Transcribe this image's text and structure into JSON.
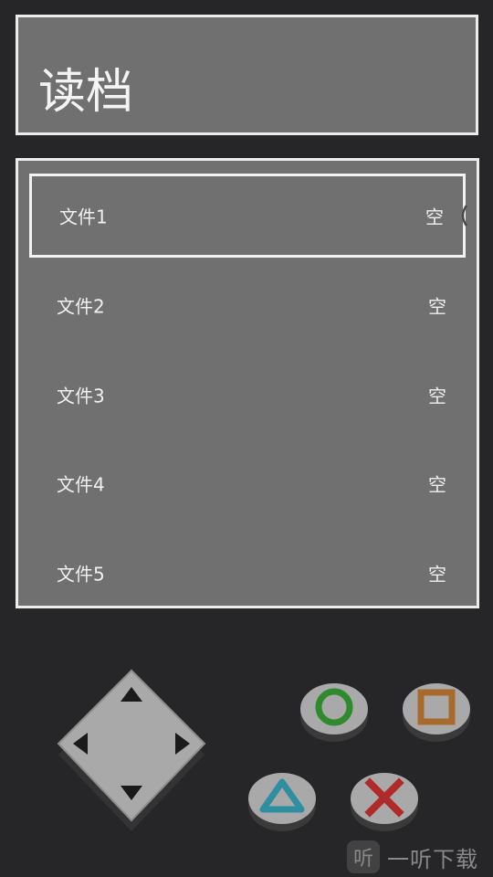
{
  "header": {
    "title": "读档"
  },
  "save_slots": [
    {
      "name": "文件1",
      "status": "空",
      "selected": true
    },
    {
      "name": "文件2",
      "status": "空",
      "selected": false
    },
    {
      "name": "文件3",
      "status": "空",
      "selected": false
    },
    {
      "name": "文件4",
      "status": "空",
      "selected": false
    },
    {
      "name": "文件5",
      "status": "空",
      "selected": false
    }
  ],
  "controls": {
    "dpad_icons": [
      "arrow-up-icon",
      "arrow-down-icon",
      "arrow-left-icon",
      "arrow-right-icon"
    ],
    "buttons": [
      {
        "symbol": "circle-icon",
        "color": "#2e8a2c"
      },
      {
        "symbol": "square-icon",
        "color": "#a8692c"
      },
      {
        "symbol": "triangle-icon",
        "color": "#2f8ea0"
      },
      {
        "symbol": "cross-icon",
        "color": "#b02a2a"
      }
    ]
  },
  "watermark": {
    "logo": "听",
    "text": "一听下载"
  },
  "colors": {
    "background": "#262628",
    "panel": "#707070",
    "panel_border": "#ececec",
    "button_body": "#a9a9a9"
  }
}
